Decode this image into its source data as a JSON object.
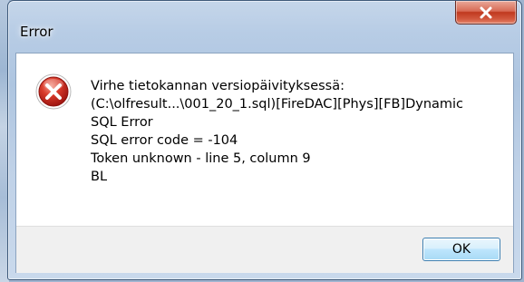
{
  "window": {
    "title": "Error"
  },
  "dialog": {
    "icon": "error-icon",
    "message_lines": [
      "Virhe tietokannan versiopäivityksessä:",
      "(C:\\olfresult...\\001_20_1.sql)[FireDAC][Phys][FB]Dynamic",
      "SQL Error",
      "SQL error code = -104",
      "Token unknown - line 5, column 9",
      "BL"
    ],
    "ok_label": "OK"
  },
  "colors": {
    "close_button": "#c0391f",
    "error_icon": "#c8261d",
    "ok_button_border": "#3c7fb1"
  }
}
